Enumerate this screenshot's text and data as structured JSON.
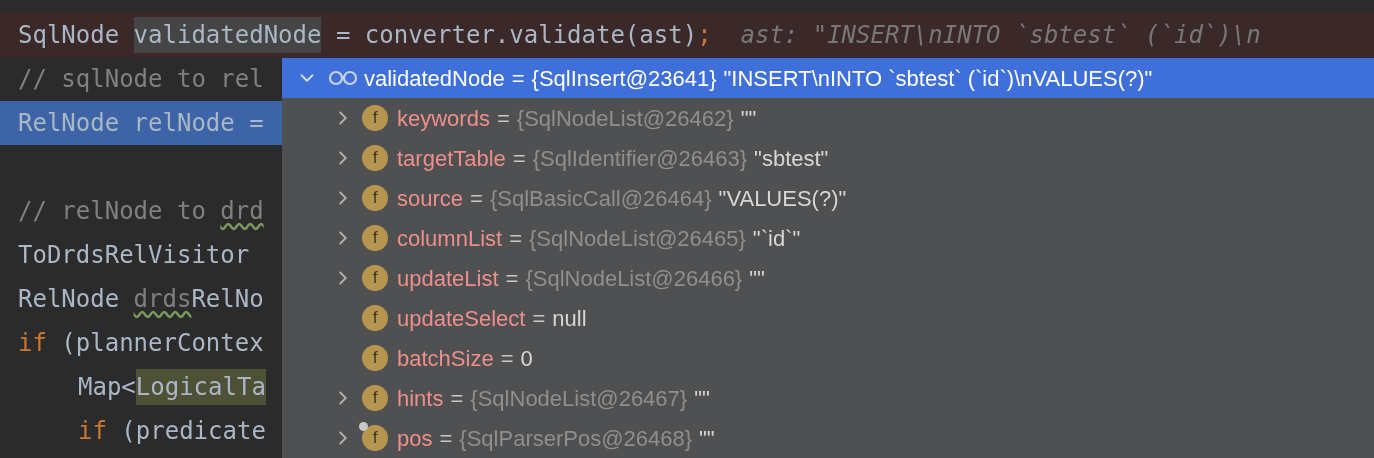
{
  "code_lines": [
    {
      "kind": "breakpoint",
      "selected": false,
      "indented": false,
      "segments": [
        {
          "kind": "plain",
          "text": "SqlNode "
        },
        {
          "kind": "highlight",
          "text": "validatedNode"
        },
        {
          "kind": "plain",
          "text": " = converter.validate(ast)"
        },
        {
          "kind": "punct",
          "text": ";"
        },
        {
          "kind": "hint",
          "text": "  ast: \"INSERT\\nINTO `sbtest` (`id`)\\n"
        }
      ]
    },
    {
      "kind": "normal",
      "selected": false,
      "indented": false,
      "segments": [
        {
          "kind": "comment",
          "text": "// sqlNode to rel"
        }
      ]
    },
    {
      "kind": "normal",
      "selected": true,
      "indented": false,
      "segments": [
        {
          "kind": "plain",
          "text": "RelNode relNode ="
        }
      ]
    },
    {
      "kind": "blank",
      "selected": false
    },
    {
      "kind": "normal",
      "selected": false,
      "indented": false,
      "segments": [
        {
          "kind": "comment",
          "text": "// relNode to "
        },
        {
          "kind": "typo",
          "text": "drd"
        }
      ]
    },
    {
      "kind": "normal",
      "selected": false,
      "indented": false,
      "segments": [
        {
          "kind": "plain",
          "text": "ToDrdsRelVisitor"
        }
      ]
    },
    {
      "kind": "normal",
      "selected": false,
      "indented": false,
      "segments": [
        {
          "kind": "plain",
          "text": "RelNode "
        },
        {
          "kind": "typo",
          "text": "drds"
        },
        {
          "kind": "plain",
          "text": "RelNo"
        }
      ]
    },
    {
      "kind": "normal",
      "selected": false,
      "indented": false,
      "segments": [
        {
          "kind": "keyword",
          "text": "if"
        },
        {
          "kind": "plain",
          "text": " (plannerContex"
        }
      ]
    },
    {
      "kind": "normal",
      "selected": false,
      "indented": true,
      "segments": [
        {
          "kind": "plain",
          "text": "Map<"
        },
        {
          "kind": "match",
          "text": "LogicalTa"
        }
      ]
    },
    {
      "kind": "normal",
      "selected": false,
      "indented": true,
      "segments": [
        {
          "kind": "keyword",
          "text": "if"
        },
        {
          "kind": "plain",
          "text": " (predicate"
        }
      ]
    }
  ],
  "debug_popup": {
    "header": {
      "name": "validatedNode",
      "operator": "=",
      "type_ref": "{SqlInsert@23641}",
      "value": "\"INSERT\\nINTO `sbtest` (`id`)\\nVALUES(?)\"",
      "expanded": true,
      "selected": true
    },
    "fields": [
      {
        "badge": "f",
        "name": "keywords",
        "operator": "=",
        "type_ref": "{SqlNodeList@26462}",
        "value": "\"\"",
        "expandable": true,
        "marked": false
      },
      {
        "badge": "f",
        "name": "targetTable",
        "operator": "=",
        "type_ref": "{SqlIdentifier@26463}",
        "value": "\"sbtest\"",
        "expandable": true,
        "marked": false
      },
      {
        "badge": "f",
        "name": "source",
        "operator": "=",
        "type_ref": "{SqlBasicCall@26464}",
        "value": "\"VALUES(?)\"",
        "expandable": true,
        "marked": false
      },
      {
        "badge": "f",
        "name": "columnList",
        "operator": "=",
        "type_ref": "{SqlNodeList@26465}",
        "value": "\"`id`\"",
        "expandable": true,
        "marked": false
      },
      {
        "badge": "f",
        "name": "updateList",
        "operator": "=",
        "type_ref": "{SqlNodeList@26466}",
        "value": "\"\"",
        "expandable": true,
        "marked": false
      },
      {
        "badge": "f",
        "name": "updateSelect",
        "operator": "=",
        "value": "null",
        "expandable": false,
        "marked": false
      },
      {
        "badge": "f",
        "name": "batchSize",
        "operator": "=",
        "value": "0",
        "expandable": false,
        "marked": false
      },
      {
        "badge": "f",
        "name": "hints",
        "operator": "=",
        "type_ref": "{SqlNodeList@26467}",
        "value": "\"\"",
        "expandable": true,
        "marked": false
      },
      {
        "badge": "f",
        "name": "pos",
        "operator": "=",
        "type_ref": "{SqlParserPos@26468}",
        "value": "\"\"",
        "expandable": true,
        "marked": true
      }
    ]
  }
}
